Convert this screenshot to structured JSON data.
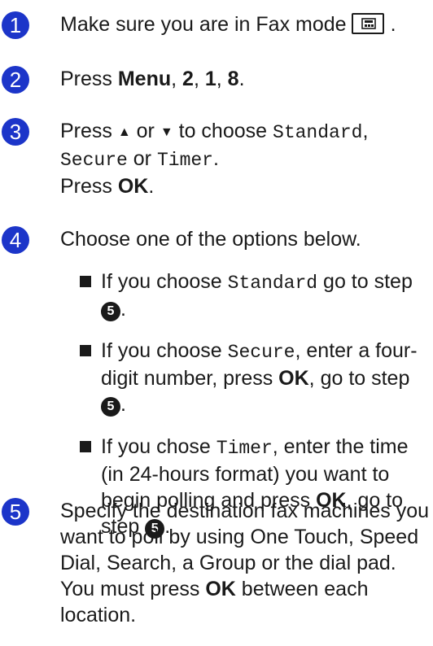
{
  "steps": [
    {
      "number": "1",
      "text": "Make sure you are in Fax mode",
      "icon": "fax-mode-key-icon"
    },
    {
      "number": "2",
      "press": "Press",
      "menu": "Menu",
      "sep1": ",",
      "k1": "2",
      "sep2": ",",
      "k2": "1",
      "sep3": ",",
      "k3": "8",
      "end": "."
    },
    {
      "number": "3",
      "press": "Press",
      "up_symbol": "▲",
      "or": "or",
      "down_symbol": "▼",
      "to_choose": "to choose",
      "opt1": "Standard",
      "opt2": "Secure",
      "or2": "or",
      "opt3": "Timer",
      "end": ".",
      "press2": "Press",
      "ok": "OK",
      "end2": "."
    },
    {
      "number": "4",
      "text": "Choose one of the options below.",
      "bullets": [
        {
          "pre": "If you choose",
          "code": "Standard",
          "post": "go to step",
          "ref": "5",
          "end": "."
        },
        {
          "pre": "If you choose",
          "code": "Secure",
          "post": ", enter a four-digit number, press",
          "ok": "OK",
          "post2": ", go to step",
          "ref": "5",
          "end": "."
        },
        {
          "pre": "If you chose",
          "code": "Timer",
          "post": ", enter the time (in 24-hours format) you want to begin polling and press",
          "ok": "OK",
          "post2": ", go to step",
          "ref": "5",
          "end": "."
        }
      ]
    },
    {
      "number": "5",
      "text": "Specify the destination fax machines you want to poll by using One Touch, Speed Dial, Search, a Group or the dial pad. You must press",
      "ok": "OK",
      "post": "between each location."
    }
  ],
  "colors": {
    "step_badge": "#1c35c9",
    "text": "#1a1a1a"
  }
}
